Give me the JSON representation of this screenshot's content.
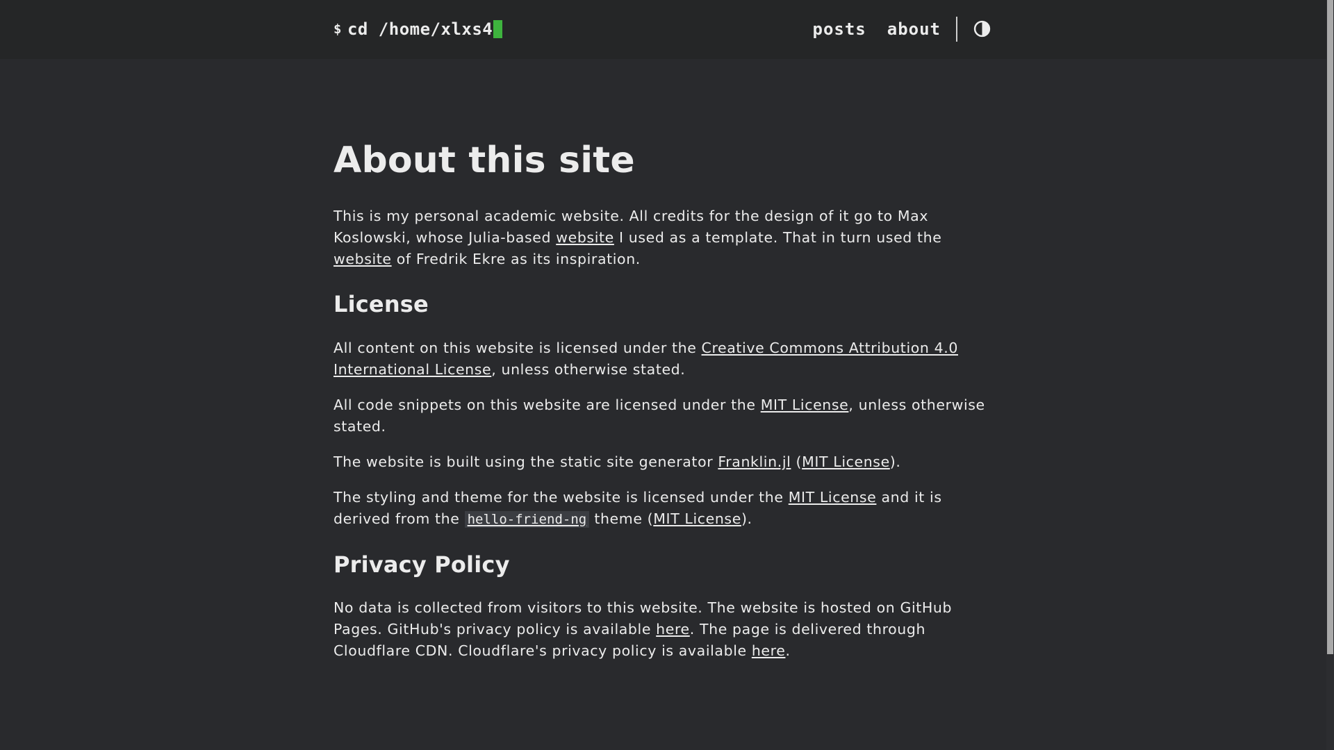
{
  "header": {
    "prompt": "$",
    "brand_text": "cd /home/xlxs4",
    "nav": [
      {
        "label": "posts"
      },
      {
        "label": "about"
      }
    ],
    "theme_toggle_icon": "half-circle-contrast-icon"
  },
  "main": {
    "title": "About this site",
    "intro": {
      "t1": "This is my personal academic website. All credits for the design of it go to Max Koslowski, whose Julia-based ",
      "link1": "website",
      "t2": " I used as a template. That in turn used the ",
      "link2": "website",
      "t3": " of Fredrik Ekre as its inspiration."
    },
    "license_heading": "License",
    "license_p1": {
      "t1": "All content on this website is licensed under the ",
      "link": "Creative Commons Attribution 4.0 International License",
      "t2": ", unless otherwise stated."
    },
    "license_p2": {
      "t1": "All code snippets on this website are licensed under the ",
      "link": "MIT License",
      "t2": ", unless otherwise stated."
    },
    "license_p3": {
      "t1": "The website is built using the static site generator ",
      "link1": "Franklin.jl",
      "t2": " (",
      "link2": "MIT License",
      "t3": ")."
    },
    "license_p4": {
      "t1": "The styling and theme for the website is licensed under the ",
      "link1": "MIT License",
      "t2": " and it is derived from the ",
      "code": "hello-friend-ng",
      "t3": " theme (",
      "link2": "MIT License",
      "t4": ")."
    },
    "privacy_heading": "Privacy Policy",
    "privacy_p": {
      "t1": "No data is collected from visitors to this website. The website is hosted on GitHub Pages. GitHub's privacy policy is available ",
      "link1": "here",
      "t2": ". The page is delivered through Cloudflare CDN. Cloudflare's privacy policy is available ",
      "link2": "here",
      "t3": "."
    }
  },
  "colors": {
    "background": "#292a2d",
    "header_background": "#252627",
    "text": "#ececec",
    "cursor_accent": "#3eb33e"
  }
}
